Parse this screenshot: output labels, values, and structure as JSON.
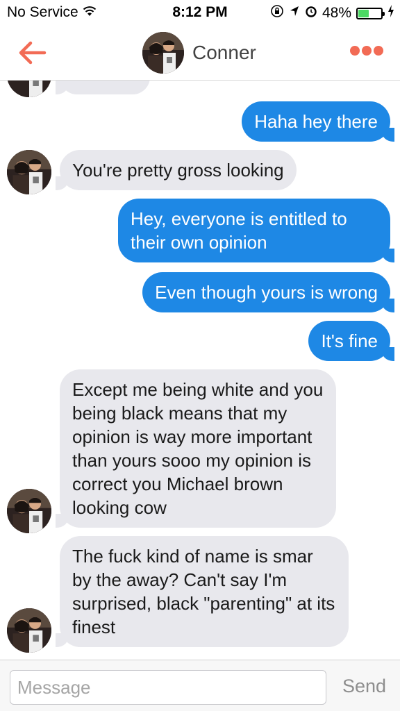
{
  "status_bar": {
    "carrier": "No Service",
    "time": "8:12 PM",
    "battery_percent": "48%",
    "battery_level": 0.48,
    "icons": [
      "wifi-icon",
      "lock-rotation-icon",
      "location-arrow-icon",
      "alarm-icon",
      "battery-icon",
      "charging-bolt-icon"
    ]
  },
  "header": {
    "back_icon": "back-arrow-icon",
    "contact_name": "Conner",
    "more_icon": "more-dots-icon",
    "accent_color": "#f26b55"
  },
  "messages": [
    {
      "sender": "contact",
      "text": ""
    },
    {
      "sender": "me",
      "text": "Haha hey there"
    },
    {
      "sender": "contact",
      "text": "You're pretty gross looking"
    },
    {
      "sender": "me",
      "text": "Hey, everyone is entitled to their own opinion"
    },
    {
      "sender": "me",
      "text": "Even though yours is wrong"
    },
    {
      "sender": "me",
      "text": "It's fine"
    },
    {
      "sender": "contact",
      "text": "Except me being white and you being black means that my opinion is way more important than yours sooo my opinion is correct you Michael brown looking cow"
    },
    {
      "sender": "contact",
      "text": "The fuck kind of name is smar by the away? Can't say I'm surprised, black \"parenting\" at its finest"
    }
  ],
  "colors": {
    "outgoing_bubble": "#1e88e5",
    "incoming_bubble": "#e8e8ed"
  },
  "compose": {
    "placeholder": "Message",
    "value": "",
    "send_label": "Send"
  }
}
